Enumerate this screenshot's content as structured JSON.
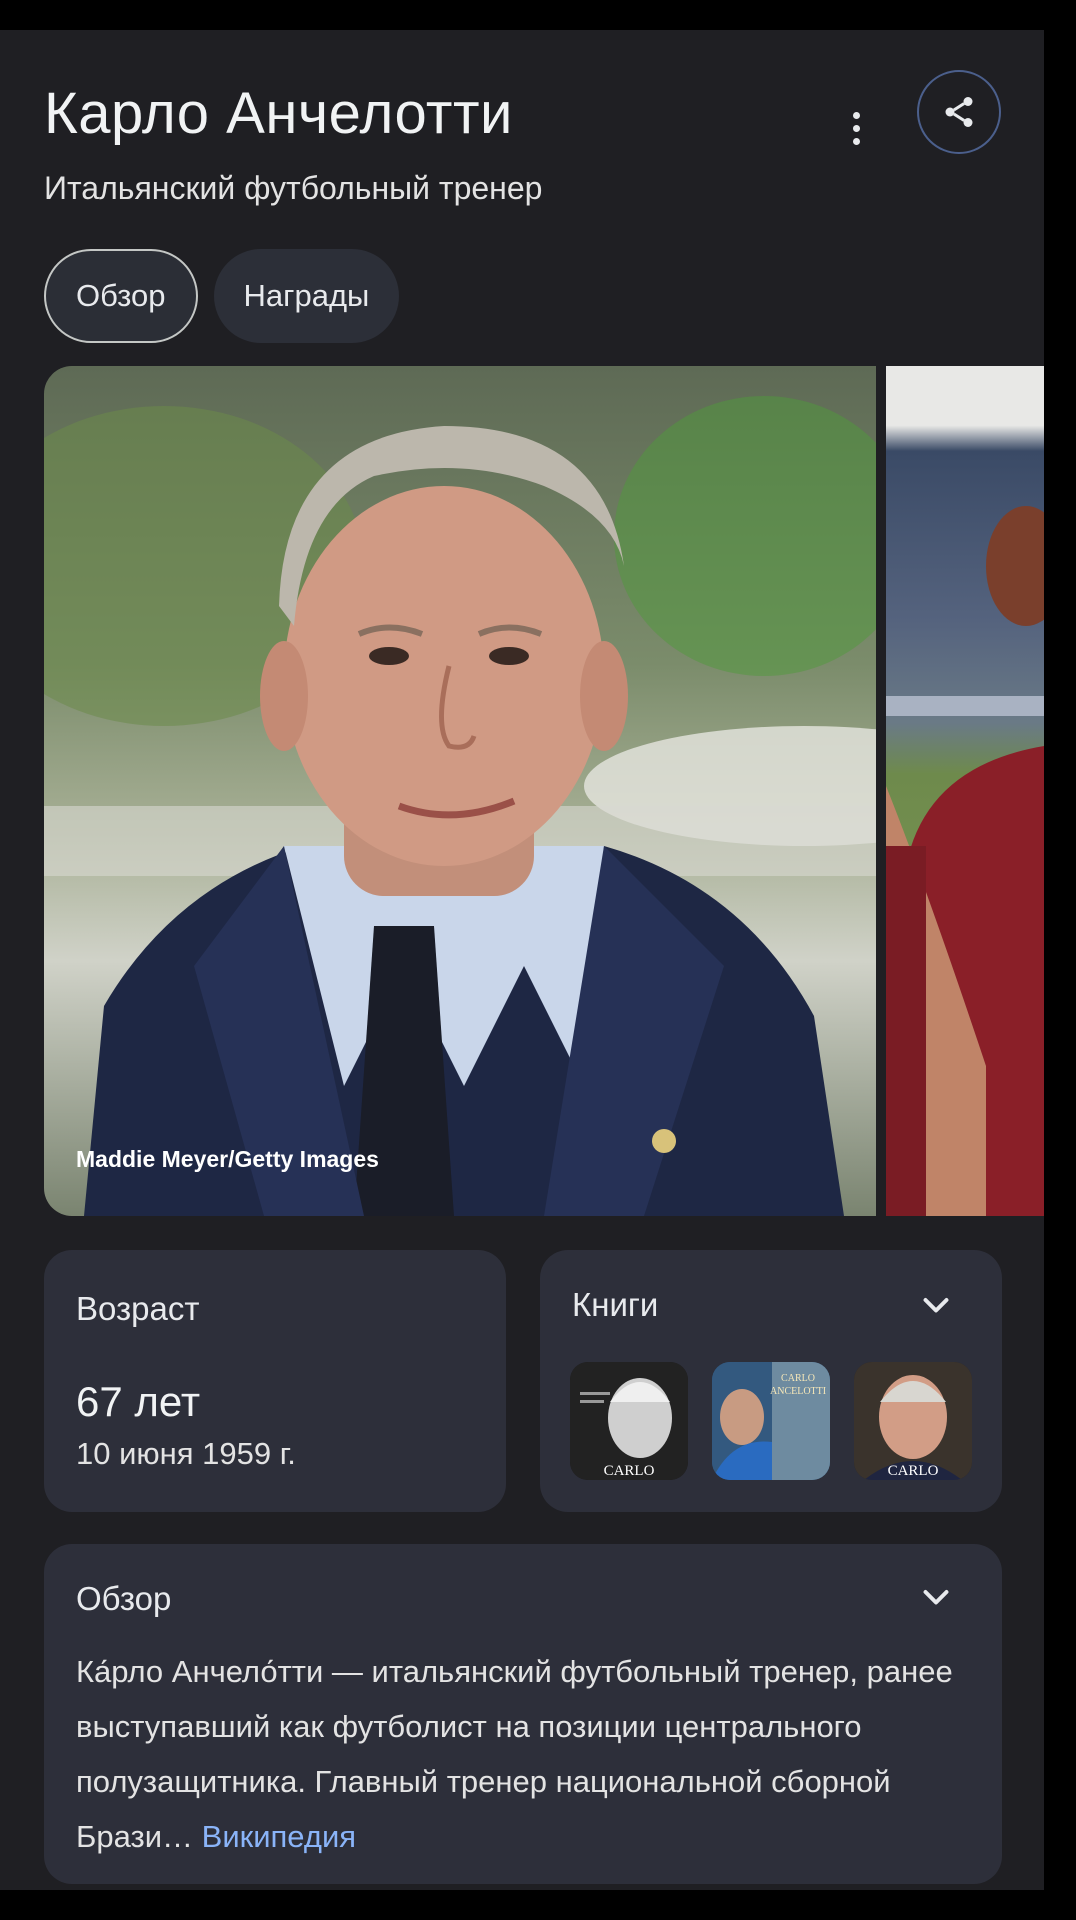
{
  "entity": {
    "title": "Карло Анчелотти",
    "subtitle": "Итальянский футбольный тренер"
  },
  "tabs": [
    {
      "label": "Обзор",
      "active": true
    },
    {
      "label": "Награды",
      "active": false
    }
  ],
  "hero": {
    "credit": "Maddie Meyer/Getty Images"
  },
  "age_card": {
    "heading": "Возраст",
    "value": "67 лет",
    "birth_date": "10 июня 1959 г."
  },
  "books_card": {
    "heading": "Книги",
    "covers": [
      {
        "label": "CARLO"
      },
      {
        "label": "CARLO ANCELOTTI"
      },
      {
        "label": "CARLO"
      }
    ]
  },
  "overview_card": {
    "heading": "Обзор",
    "text": "Ка́рло Анчело́тти — итальянский футбольный тренер, ранее выступавший как футболист на позиции центрального полузащитника. Главный тренер национальной сборной Брази…",
    "source_link": "Википедия"
  },
  "colors": {
    "panel": "#1f1f23",
    "card": "#2d2f3a",
    "link": "#8ab4f8",
    "share_border": "#4b5f8c"
  }
}
